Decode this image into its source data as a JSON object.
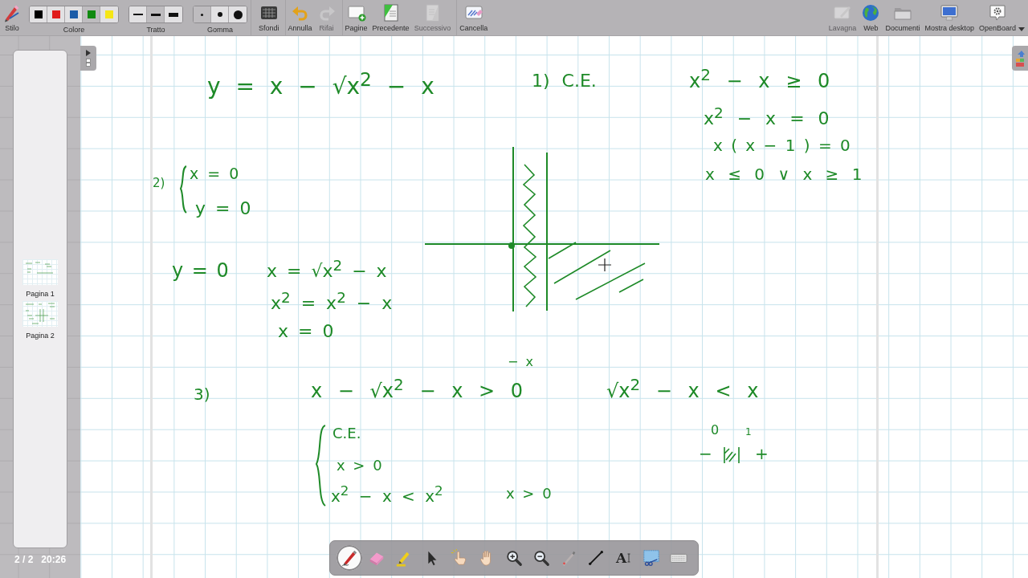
{
  "toolbar": {
    "left": [
      {
        "kind": "stylus",
        "label": "Stilo",
        "disabled": false
      },
      {
        "kind": "colors",
        "label": "Colore",
        "options": [
          {
            "color": "#000000",
            "selected": false
          },
          {
            "color": "#e01b1b",
            "selected": false
          },
          {
            "color": "#1c5ca8",
            "selected": false
          },
          {
            "color": "#118a11",
            "selected": true
          },
          {
            "color": "#f5e616",
            "selected": false
          }
        ]
      },
      {
        "kind": "stroke",
        "label": "Tratto",
        "options": [
          {
            "selected": false
          },
          {
            "selected": true
          },
          {
            "selected": false
          }
        ]
      },
      {
        "kind": "eraser",
        "label": "Gomma",
        "options": [
          {
            "selected": true
          },
          {
            "selected": false
          },
          {
            "selected": false
          }
        ]
      },
      {
        "kind": "backgrounds",
        "label": "Sfondi",
        "disabled": false
      },
      {
        "kind": "undo",
        "label": "Annulla",
        "disabled": false
      },
      {
        "kind": "redo",
        "label": "Rifai",
        "disabled": true
      },
      {
        "kind": "pages",
        "label": "Pagine",
        "disabled": false
      },
      {
        "kind": "previous",
        "label": "Precedente",
        "disabled": false
      },
      {
        "kind": "next",
        "label": "Successivo",
        "disabled": true
      },
      {
        "kind": "clear",
        "label": "Cancella",
        "disabled": false
      }
    ],
    "right": [
      {
        "kind": "board",
        "label": "Lavagna",
        "disabled": true
      },
      {
        "kind": "web",
        "label": "Web",
        "disabled": false
      },
      {
        "kind": "documents",
        "label": "Documenti",
        "disabled": false
      },
      {
        "kind": "desktop",
        "label": "Mostra desktop",
        "disabled": false
      },
      {
        "kind": "openboard",
        "label": "OpenBoard",
        "disabled": false
      }
    ]
  },
  "sidebar": {
    "pages": [
      {
        "label": "Pagina 1"
      },
      {
        "label": "Pagina 2"
      }
    ],
    "page_count": "2 / 2",
    "clock": "20:26"
  },
  "board": {
    "ink": [
      {
        "text": "y = x − √x$^{2}$ − x"
      },
      {
        "text": "1) C.E."
      },
      {
        "text": "x$^{2}$ − x ≥ 0"
      },
      {
        "text": "x$^{2}$ − x = 0"
      },
      {
        "text": "x ( x − 1 ) = 0"
      },
      {
        "text": "x ≤ 0 ∨ x ≥ 1"
      },
      {
        "text": "2)"
      },
      {
        "text": "x = 0"
      },
      {
        "text": "y = 0"
      },
      {
        "text": "y = 0"
      },
      {
        "text": "x = √x$^{2}$ − x"
      },
      {
        "text": "x$^{2}$ = x$^{2}$ − x"
      },
      {
        "text": "x = 0"
      },
      {
        "text": "− x"
      },
      {
        "text": "3)"
      },
      {
        "text": "x − √x$^{2}$ − x > 0"
      },
      {
        "text": "√x$^{2}$ − x < x"
      },
      {
        "text": "C.E."
      },
      {
        "text": "x > 0"
      },
      {
        "text": "x$^{2}$ − x < x$^{2}$"
      },
      {
        "text": "x > 0"
      },
      {
        "text": "0"
      },
      {
        "text": "1"
      },
      {
        "text": "−"
      },
      {
        "text": "+"
      }
    ]
  },
  "dock": {
    "tools": [
      {
        "kind": "pen",
        "selected": true
      },
      {
        "kind": "eraser",
        "selected": false
      },
      {
        "kind": "marker",
        "selected": false
      },
      {
        "kind": "selector",
        "selected": false
      },
      {
        "kind": "interact",
        "selected": false
      },
      {
        "kind": "hand",
        "selected": false
      },
      {
        "kind": "zoom-in",
        "selected": false
      },
      {
        "kind": "zoom-out",
        "selected": false
      },
      {
        "kind": "laser",
        "selected": false
      },
      {
        "kind": "line",
        "selected": false
      },
      {
        "kind": "text",
        "glyph": "A",
        "selected": false
      },
      {
        "kind": "capture",
        "selected": false
      },
      {
        "kind": "keyboard",
        "selected": false
      }
    ]
  }
}
